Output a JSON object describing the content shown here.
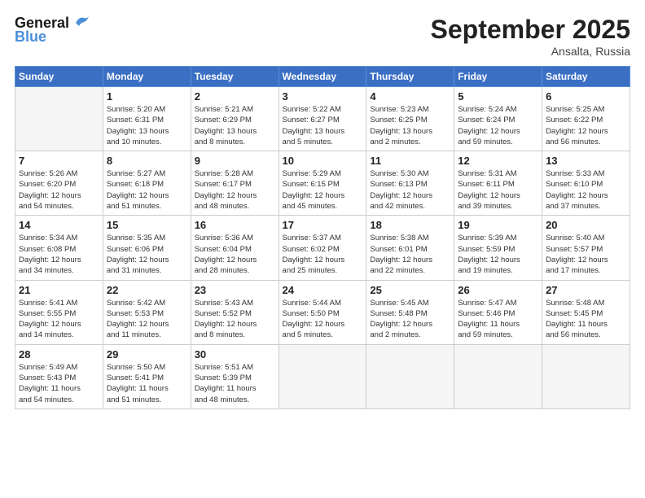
{
  "header": {
    "logo_general": "General",
    "logo_blue": "Blue",
    "month_title": "September 2025",
    "subtitle": "Ansalta, Russia"
  },
  "columns": [
    "Sunday",
    "Monday",
    "Tuesday",
    "Wednesday",
    "Thursday",
    "Friday",
    "Saturday"
  ],
  "weeks": [
    [
      {
        "num": "",
        "sunrise": "",
        "sunset": "",
        "daylight": ""
      },
      {
        "num": "1",
        "sunrise": "Sunrise: 5:20 AM",
        "sunset": "Sunset: 6:31 PM",
        "daylight": "Daylight: 13 hours and 10 minutes."
      },
      {
        "num": "2",
        "sunrise": "Sunrise: 5:21 AM",
        "sunset": "Sunset: 6:29 PM",
        "daylight": "Daylight: 13 hours and 8 minutes."
      },
      {
        "num": "3",
        "sunrise": "Sunrise: 5:22 AM",
        "sunset": "Sunset: 6:27 PM",
        "daylight": "Daylight: 13 hours and 5 minutes."
      },
      {
        "num": "4",
        "sunrise": "Sunrise: 5:23 AM",
        "sunset": "Sunset: 6:25 PM",
        "daylight": "Daylight: 13 hours and 2 minutes."
      },
      {
        "num": "5",
        "sunrise": "Sunrise: 5:24 AM",
        "sunset": "Sunset: 6:24 PM",
        "daylight": "Daylight: 12 hours and 59 minutes."
      },
      {
        "num": "6",
        "sunrise": "Sunrise: 5:25 AM",
        "sunset": "Sunset: 6:22 PM",
        "daylight": "Daylight: 12 hours and 56 minutes."
      }
    ],
    [
      {
        "num": "7",
        "sunrise": "Sunrise: 5:26 AM",
        "sunset": "Sunset: 6:20 PM",
        "daylight": "Daylight: 12 hours and 54 minutes."
      },
      {
        "num": "8",
        "sunrise": "Sunrise: 5:27 AM",
        "sunset": "Sunset: 6:18 PM",
        "daylight": "Daylight: 12 hours and 51 minutes."
      },
      {
        "num": "9",
        "sunrise": "Sunrise: 5:28 AM",
        "sunset": "Sunset: 6:17 PM",
        "daylight": "Daylight: 12 hours and 48 minutes."
      },
      {
        "num": "10",
        "sunrise": "Sunrise: 5:29 AM",
        "sunset": "Sunset: 6:15 PM",
        "daylight": "Daylight: 12 hours and 45 minutes."
      },
      {
        "num": "11",
        "sunrise": "Sunrise: 5:30 AM",
        "sunset": "Sunset: 6:13 PM",
        "daylight": "Daylight: 12 hours and 42 minutes."
      },
      {
        "num": "12",
        "sunrise": "Sunrise: 5:31 AM",
        "sunset": "Sunset: 6:11 PM",
        "daylight": "Daylight: 12 hours and 39 minutes."
      },
      {
        "num": "13",
        "sunrise": "Sunrise: 5:33 AM",
        "sunset": "Sunset: 6:10 PM",
        "daylight": "Daylight: 12 hours and 37 minutes."
      }
    ],
    [
      {
        "num": "14",
        "sunrise": "Sunrise: 5:34 AM",
        "sunset": "Sunset: 6:08 PM",
        "daylight": "Daylight: 12 hours and 34 minutes."
      },
      {
        "num": "15",
        "sunrise": "Sunrise: 5:35 AM",
        "sunset": "Sunset: 6:06 PM",
        "daylight": "Daylight: 12 hours and 31 minutes."
      },
      {
        "num": "16",
        "sunrise": "Sunrise: 5:36 AM",
        "sunset": "Sunset: 6:04 PM",
        "daylight": "Daylight: 12 hours and 28 minutes."
      },
      {
        "num": "17",
        "sunrise": "Sunrise: 5:37 AM",
        "sunset": "Sunset: 6:02 PM",
        "daylight": "Daylight: 12 hours and 25 minutes."
      },
      {
        "num": "18",
        "sunrise": "Sunrise: 5:38 AM",
        "sunset": "Sunset: 6:01 PM",
        "daylight": "Daylight: 12 hours and 22 minutes."
      },
      {
        "num": "19",
        "sunrise": "Sunrise: 5:39 AM",
        "sunset": "Sunset: 5:59 PM",
        "daylight": "Daylight: 12 hours and 19 minutes."
      },
      {
        "num": "20",
        "sunrise": "Sunrise: 5:40 AM",
        "sunset": "Sunset: 5:57 PM",
        "daylight": "Daylight: 12 hours and 17 minutes."
      }
    ],
    [
      {
        "num": "21",
        "sunrise": "Sunrise: 5:41 AM",
        "sunset": "Sunset: 5:55 PM",
        "daylight": "Daylight: 12 hours and 14 minutes."
      },
      {
        "num": "22",
        "sunrise": "Sunrise: 5:42 AM",
        "sunset": "Sunset: 5:53 PM",
        "daylight": "Daylight: 12 hours and 11 minutes."
      },
      {
        "num": "23",
        "sunrise": "Sunrise: 5:43 AM",
        "sunset": "Sunset: 5:52 PM",
        "daylight": "Daylight: 12 hours and 8 minutes."
      },
      {
        "num": "24",
        "sunrise": "Sunrise: 5:44 AM",
        "sunset": "Sunset: 5:50 PM",
        "daylight": "Daylight: 12 hours and 5 minutes."
      },
      {
        "num": "25",
        "sunrise": "Sunrise: 5:45 AM",
        "sunset": "Sunset: 5:48 PM",
        "daylight": "Daylight: 12 hours and 2 minutes."
      },
      {
        "num": "26",
        "sunrise": "Sunrise: 5:47 AM",
        "sunset": "Sunset: 5:46 PM",
        "daylight": "Daylight: 11 hours and 59 minutes."
      },
      {
        "num": "27",
        "sunrise": "Sunrise: 5:48 AM",
        "sunset": "Sunset: 5:45 PM",
        "daylight": "Daylight: 11 hours and 56 minutes."
      }
    ],
    [
      {
        "num": "28",
        "sunrise": "Sunrise: 5:49 AM",
        "sunset": "Sunset: 5:43 PM",
        "daylight": "Daylight: 11 hours and 54 minutes."
      },
      {
        "num": "29",
        "sunrise": "Sunrise: 5:50 AM",
        "sunset": "Sunset: 5:41 PM",
        "daylight": "Daylight: 11 hours and 51 minutes."
      },
      {
        "num": "30",
        "sunrise": "Sunrise: 5:51 AM",
        "sunset": "Sunset: 5:39 PM",
        "daylight": "Daylight: 11 hours and 48 minutes."
      },
      {
        "num": "",
        "sunrise": "",
        "sunset": "",
        "daylight": ""
      },
      {
        "num": "",
        "sunrise": "",
        "sunset": "",
        "daylight": ""
      },
      {
        "num": "",
        "sunrise": "",
        "sunset": "",
        "daylight": ""
      },
      {
        "num": "",
        "sunrise": "",
        "sunset": "",
        "daylight": ""
      }
    ]
  ]
}
